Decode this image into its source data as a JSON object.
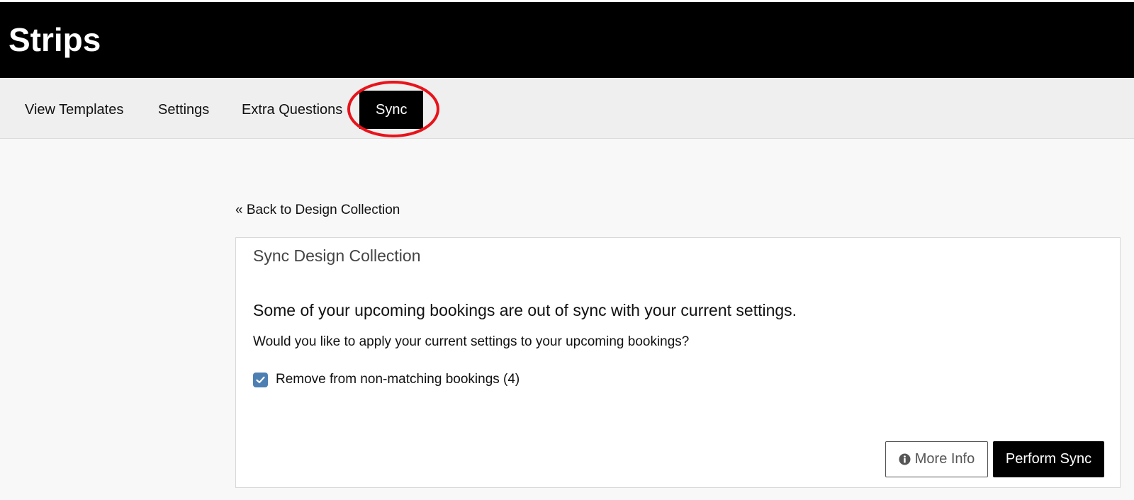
{
  "app": {
    "title": "Strips"
  },
  "nav": {
    "tabs": [
      {
        "label": "View Templates"
      },
      {
        "label": "Settings"
      },
      {
        "label": "Extra Questions"
      },
      {
        "label": "Sync",
        "active": true
      }
    ]
  },
  "main": {
    "back_link": "« Back to Design Collection",
    "panel": {
      "title": "Sync Design Collection",
      "headline": "Some of your upcoming bookings are out of sync with your current settings.",
      "question": "Would you like to apply your current settings to your upcoming bookings?",
      "checkbox": {
        "label": "Remove from non-matching bookings (4)",
        "checked": true
      },
      "buttons": {
        "more_info": "More Info",
        "perform_sync": "Perform Sync"
      }
    }
  },
  "colors": {
    "header_bg": "#000000",
    "nav_bg": "#efefef",
    "active_tab_bg": "#000000",
    "checkbox": "#4d7fb3",
    "annotation": "#e8131b"
  },
  "icons": {
    "checkbox": "check-icon",
    "more_info": "info-circle-icon"
  }
}
